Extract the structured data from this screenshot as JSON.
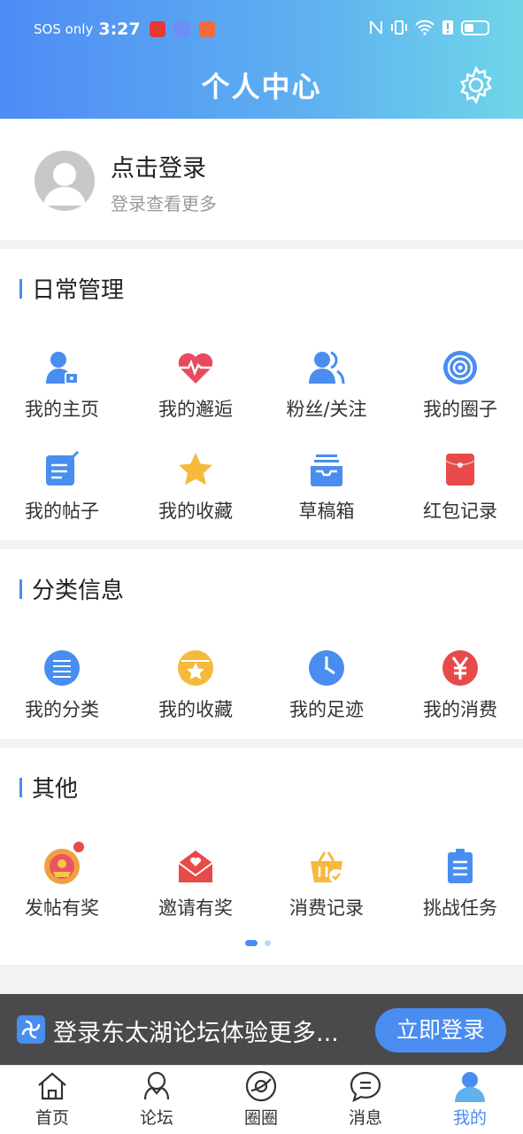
{
  "status_bar": {
    "carrier": "SOS only",
    "time": "3:27",
    "right_icons": [
      "nfc-icon",
      "vibrate-icon",
      "wifi-icon",
      "alert-icon",
      "battery-icon"
    ]
  },
  "header": {
    "title": "个人中心",
    "settings_icon": "gear-icon"
  },
  "login": {
    "title": "点击登录",
    "subtitle": "登录查看更多"
  },
  "sections": {
    "daily": {
      "title": "日常管理",
      "items": [
        {
          "label": "我的主页",
          "icon": "user-card-icon"
        },
        {
          "label": "我的邂逅",
          "icon": "heartbeat-icon"
        },
        {
          "label": "粉丝/关注",
          "icon": "followers-icon"
        },
        {
          "label": "我的圈子",
          "icon": "target-icon"
        },
        {
          "label": "我的帖子",
          "icon": "edit-note-icon"
        },
        {
          "label": "我的收藏",
          "icon": "star-icon"
        },
        {
          "label": "草稿箱",
          "icon": "inbox-tray-icon"
        },
        {
          "label": "红包记录",
          "icon": "red-envelope-icon"
        }
      ]
    },
    "classified": {
      "title": "分类信息",
      "items": [
        {
          "label": "我的分类",
          "icon": "list-icon"
        },
        {
          "label": "我的收藏",
          "icon": "star-box-icon"
        },
        {
          "label": "我的足迹",
          "icon": "clock-icon"
        },
        {
          "label": "我的消费",
          "icon": "yen-icon"
        }
      ]
    },
    "other": {
      "title": "其他",
      "items": [
        {
          "label": "发帖有奖",
          "icon": "reward-icon"
        },
        {
          "label": "邀请有奖",
          "icon": "envelope-heart-icon"
        },
        {
          "label": "消费记录",
          "icon": "basket-icon"
        },
        {
          "label": "挑战任务",
          "icon": "clipboard-icon"
        }
      ]
    }
  },
  "banner": {
    "text": "登录东太湖论坛体验更多...",
    "button": "立即登录"
  },
  "tabs": [
    {
      "label": "首页",
      "icon": "home-icon",
      "active": false
    },
    {
      "label": "论坛",
      "icon": "forum-icon",
      "active": false
    },
    {
      "label": "圈圈",
      "icon": "circle-planet-icon",
      "active": false
    },
    {
      "label": "消息",
      "icon": "chat-bubble-icon",
      "active": false
    },
    {
      "label": "我的",
      "icon": "profile-icon",
      "active": true
    }
  ],
  "colors": {
    "accent": "#4a8df0",
    "header_start": "#4e8bf5",
    "header_end": "#6fd6e8",
    "banner_bg": "#4a4a4c"
  }
}
